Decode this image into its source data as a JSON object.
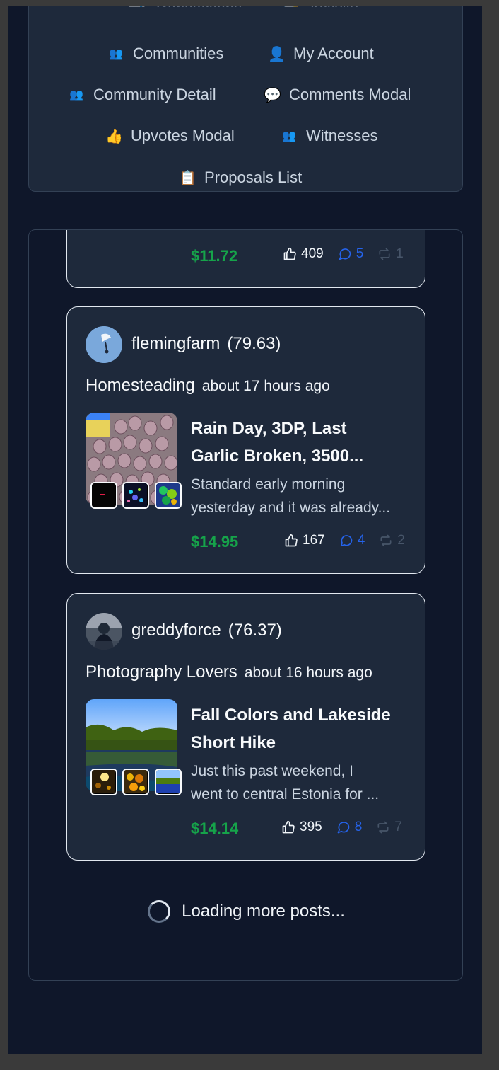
{
  "nav": {
    "links": [
      {
        "icon": "📊",
        "label": "Transactions"
      },
      {
        "icon": "📝",
        "label": "Activity"
      },
      {
        "icon": "👥",
        "label": "Communities"
      },
      {
        "icon": "👤",
        "label": "My Account"
      },
      {
        "icon": "👥",
        "label": "Community Detail"
      },
      {
        "icon": "💬",
        "label": "Comments Modal"
      },
      {
        "icon": "👍",
        "label": "Upvotes Modal"
      },
      {
        "icon": "👥",
        "label": "Witnesses"
      },
      {
        "icon": "📋",
        "label": "Proposals List"
      }
    ]
  },
  "feed": {
    "partial_post": {
      "payout": "$11.72",
      "upvotes": "409",
      "comments": "5",
      "reblogs": "1"
    },
    "posts": [
      {
        "author": "flemingfarm",
        "reputation": "(79.63)",
        "community": "Homesteading",
        "time": "about 17 hours ago",
        "title_lines": [
          "Rain Day, 3DP, Last",
          "Garlic Broken, 3500..."
        ],
        "excerpt_lines": [
          "Standard early morning",
          "yesterday and it was already..."
        ],
        "payout": "$14.95",
        "upvotes": "167",
        "comments": "4",
        "reblogs": "2"
      },
      {
        "author": "greddyforce",
        "reputation": "(76.37)",
        "community": "Photography Lovers",
        "time": "about 16 hours ago",
        "title_lines": [
          "Fall Colors and Lakeside",
          "Short Hike"
        ],
        "excerpt_lines": [
          "Just this past weekend, I",
          "went to central Estonia for ..."
        ],
        "payout": "$14.14",
        "upvotes": "395",
        "comments": "8",
        "reblogs": "7"
      }
    ],
    "loading_text": "Loading more posts..."
  },
  "colors": {
    "background": "#0f172a",
    "card": "#1e293b",
    "payout": "#16a34a",
    "comment": "#2563eb",
    "reblog": "#475569"
  }
}
